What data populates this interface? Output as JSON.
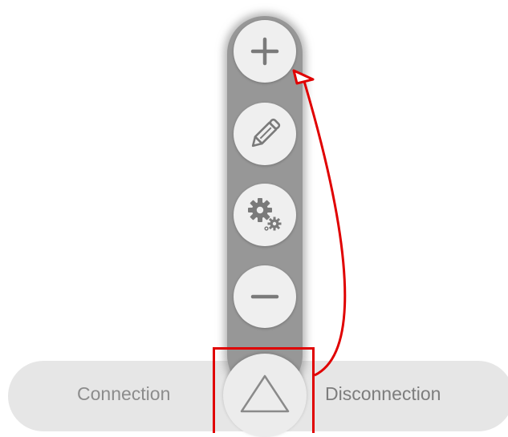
{
  "bottom_bar": {
    "left_label": "Connection",
    "right_label": "Disconnection"
  },
  "menu": {
    "buttons": [
      {
        "icon": "plus-icon"
      },
      {
        "icon": "pencil-icon"
      },
      {
        "icon": "gears-icon"
      },
      {
        "icon": "minus-icon"
      }
    ],
    "toggle_icon": "triangle-icon"
  },
  "colors": {
    "menu_background": "#979797",
    "button_fill": "#efefef",
    "icon_gray": "#7a7a7a",
    "bar_background": "#e6e6e6",
    "annotation_red": "#e00000"
  }
}
